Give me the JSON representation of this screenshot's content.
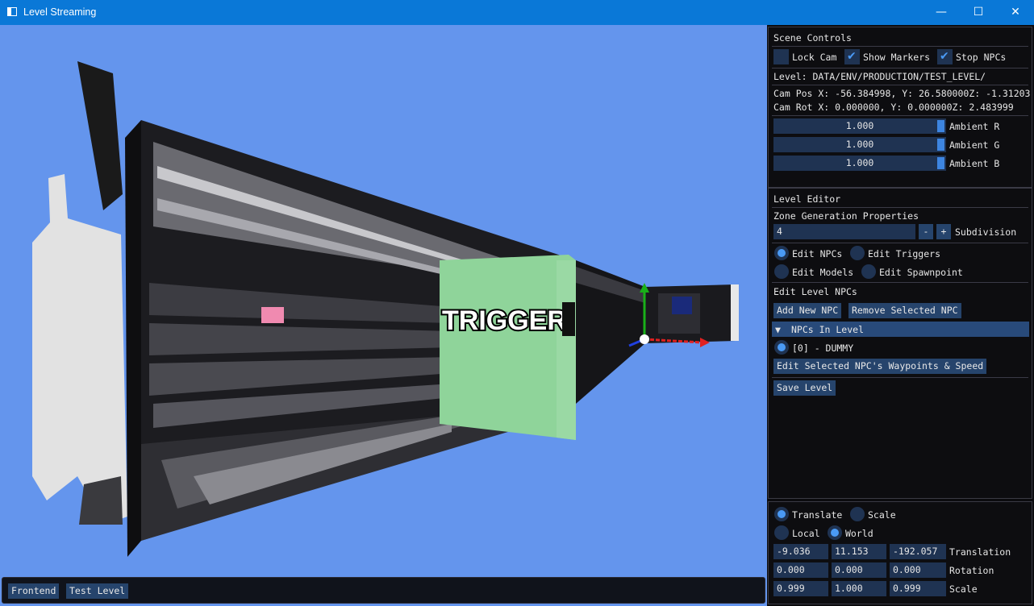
{
  "window": {
    "title": "Level Streaming",
    "min_glyph": "—",
    "max_glyph": "☐",
    "close_glyph": "✕"
  },
  "viewport": {
    "trigger_label": "TRIGGER",
    "sky_color": "#6495ed",
    "trigger_color": "#8fd49a"
  },
  "level_bar": {
    "buttons": [
      "Frontend",
      "Test Level"
    ]
  },
  "scene_controls": {
    "title": "Scene Controls",
    "lock_cam": {
      "label": "Lock Cam",
      "checked": false
    },
    "show_markers": {
      "label": "Show Markers",
      "checked": true
    },
    "stop_npcs": {
      "label": "Stop NPCs",
      "checked": true
    },
    "level_path": "Level: DATA/ENV/PRODUCTION/TEST_LEVEL/",
    "cam_pos": "Cam Pos X: -56.384998, Y: 26.580000Z: -1.31203",
    "cam_rot": "Cam Rot X: 0.000000, Y: 0.000000Z: 2.483999",
    "ambient": [
      {
        "value": "1.000",
        "label": "Ambient R"
      },
      {
        "value": "1.000",
        "label": "Ambient G"
      },
      {
        "value": "1.000",
        "label": "Ambient B"
      }
    ]
  },
  "level_editor": {
    "title": "Level Editor",
    "zone_title": "Zone Generation Properties",
    "subdivision": {
      "value": "4",
      "label": "Subdivision",
      "minus": "-",
      "plus": "+"
    },
    "modes": [
      {
        "label": "Edit NPCs",
        "selected": true
      },
      {
        "label": "Edit Triggers",
        "selected": false
      },
      {
        "label": "Edit Models",
        "selected": false
      },
      {
        "label": "Edit Spawnpoint",
        "selected": false
      }
    ],
    "npc_section_title": "Edit Level NPCs",
    "add_npc": "Add New NPC",
    "remove_npc": "Remove Selected NPC",
    "npcs_header": "NPCs In Level",
    "npcs_header_arrow": "▼",
    "npcs": [
      {
        "label": "[0] - DUMMY",
        "selected": true
      }
    ],
    "edit_waypoints": "Edit Selected NPC's Waypoints & Speed",
    "save_level": "Save Level"
  },
  "gizmo": {
    "translate": {
      "label": "Translate",
      "selected": true
    },
    "scale": {
      "label": "Scale",
      "selected": false
    },
    "local": {
      "label": "Local",
      "selected": false
    },
    "world": {
      "label": "World",
      "selected": true
    },
    "rows": [
      {
        "label": "Translation",
        "values": [
          "-9.036",
          "11.153",
          "-192.057"
        ]
      },
      {
        "label": "Rotation",
        "values": [
          "0.000",
          "0.000",
          "0.000"
        ]
      },
      {
        "label": "Scale",
        "values": [
          "0.999",
          "1.000",
          "0.999"
        ]
      }
    ]
  }
}
